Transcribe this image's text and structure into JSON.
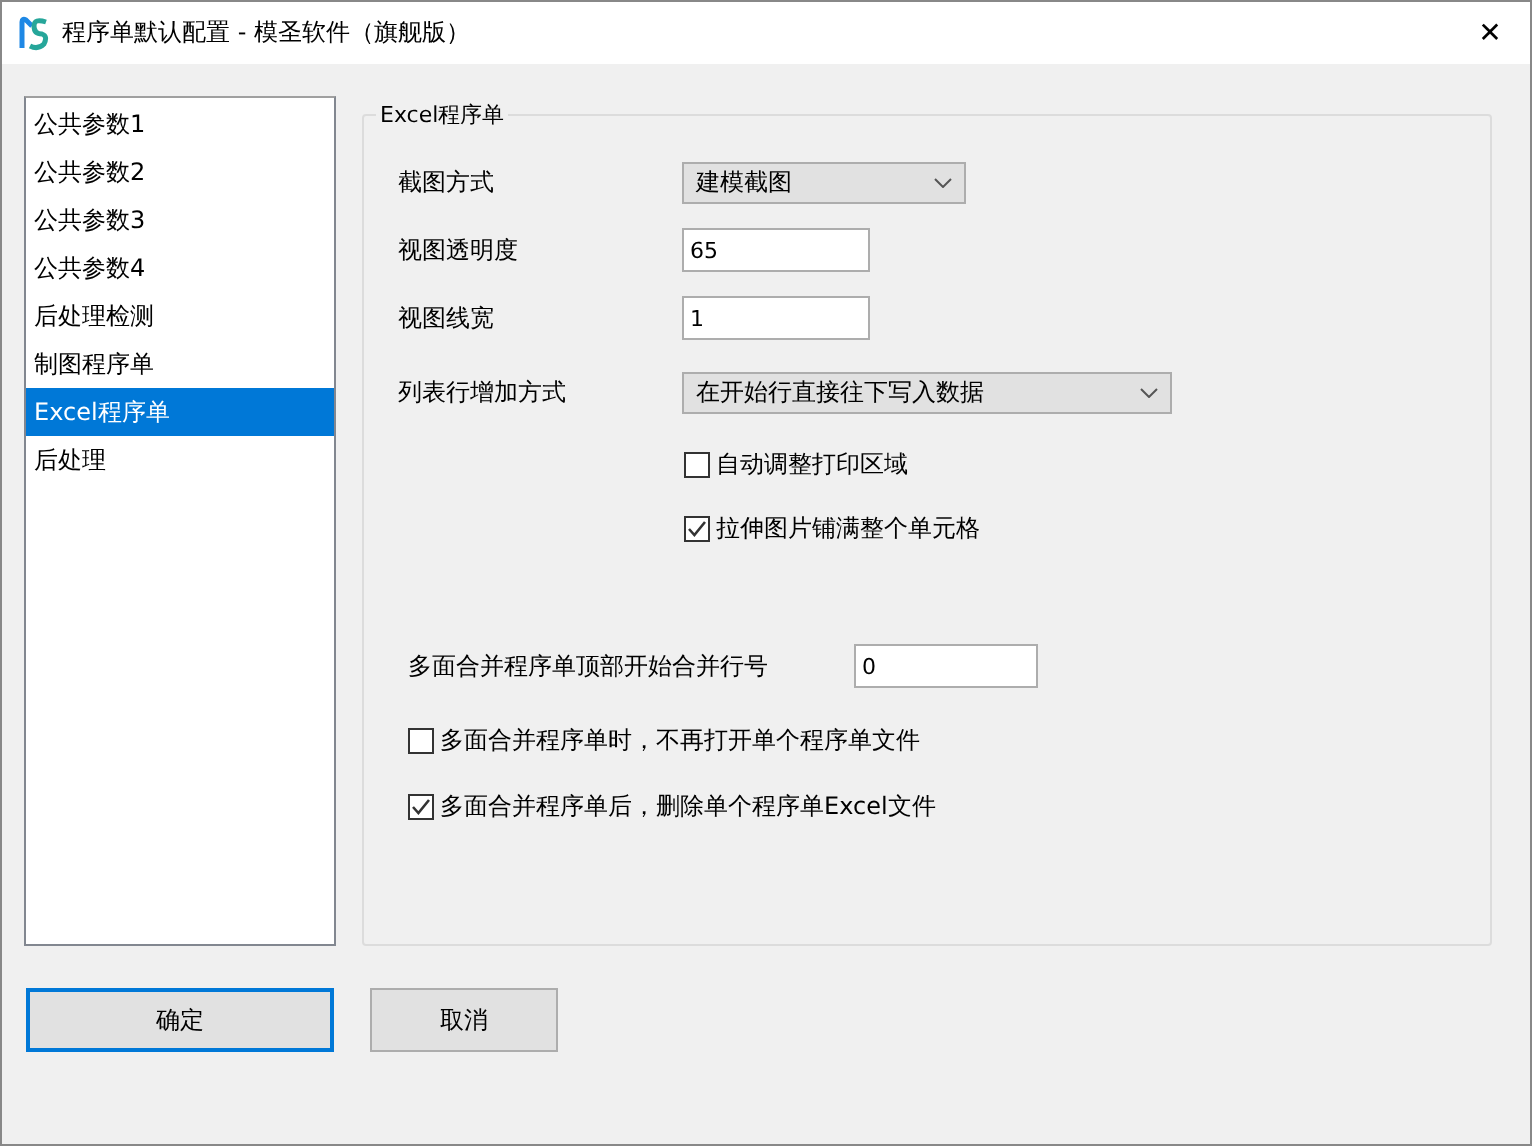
{
  "window": {
    "title": "程序单默认配置 - 模圣软件（旗舰版）",
    "close": "✕"
  },
  "sidebar": {
    "items": [
      {
        "label": "公共参数1",
        "selected": false
      },
      {
        "label": "公共参数2",
        "selected": false
      },
      {
        "label": "公共参数3",
        "selected": false
      },
      {
        "label": "公共参数4",
        "selected": false
      },
      {
        "label": "后处理检测",
        "selected": false
      },
      {
        "label": "制图程序单",
        "selected": false
      },
      {
        "label": "Excel程序单",
        "selected": true
      },
      {
        "label": "后处理",
        "selected": false
      }
    ]
  },
  "group": {
    "legend": "Excel程序单",
    "fields": [
      {
        "kind": "dropdown",
        "label": "截图方式",
        "value": "建模截图"
      },
      {
        "kind": "text",
        "label": "视图透明度",
        "value": "65"
      },
      {
        "kind": "text",
        "label": "视图线宽",
        "value": "1"
      },
      {
        "kind": "dropdown",
        "label": "列表行增加方式",
        "value": "在开始行直接往下写入数据"
      }
    ],
    "options": [
      {
        "label": "自动调整打印区域",
        "checked": false
      },
      {
        "label": "拉伸图片铺满整个单元格",
        "checked": true
      }
    ],
    "merge_field": {
      "label": "多面合并程序单顶部开始合并行号",
      "value": "0"
    },
    "merge_options": [
      {
        "label": "多面合并程序单时，不再打开单个程序单文件",
        "checked": false
      },
      {
        "label": "多面合并程序单后，删除单个程序单Excel文件",
        "checked": true
      }
    ]
  },
  "buttons": [
    {
      "label": "确定",
      "focused": true
    },
    {
      "label": "取消",
      "focused": false
    }
  ]
}
